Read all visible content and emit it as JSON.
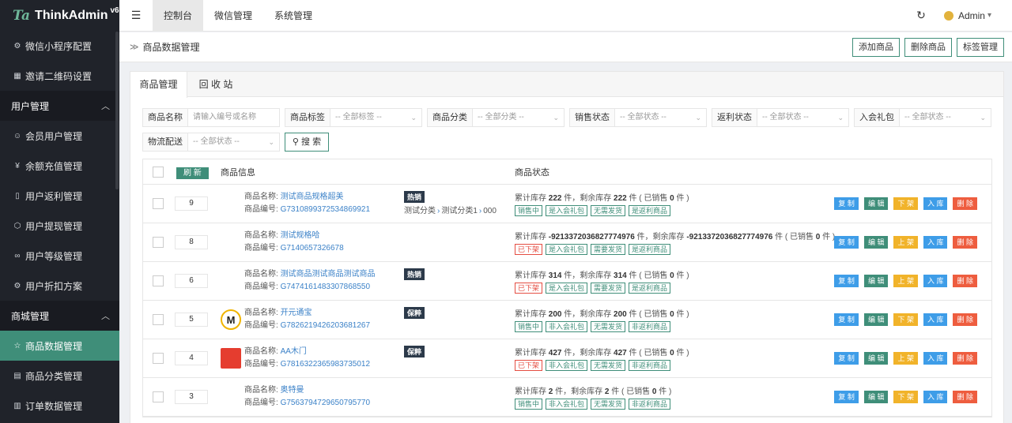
{
  "brand": {
    "name": "ThinkAdmin",
    "version": "v6",
    "mark": "Ta"
  },
  "sidebar": {
    "items_top": [
      {
        "label": "微信小程序配置",
        "icon": "gear-icon",
        "glyph": "⚙"
      },
      {
        "label": "邀请二维码设置",
        "icon": "qrcode-icon",
        "glyph": "▦"
      }
    ],
    "group_user": {
      "label": "用户管理",
      "chevron": "︿"
    },
    "items_user": [
      {
        "label": "会员用户管理",
        "icon": "user-icon",
        "glyph": "☺"
      },
      {
        "label": "余额充值管理",
        "icon": "yen-icon",
        "glyph": "¥"
      },
      {
        "label": "用户返利管理",
        "icon": "rebate-icon",
        "glyph": "▯"
      },
      {
        "label": "用户提现管理",
        "icon": "cube-icon",
        "glyph": "⬡"
      },
      {
        "label": "用户等级管理",
        "icon": "infinity-icon",
        "glyph": "∞"
      },
      {
        "label": "用户折扣方案",
        "icon": "settings-icon",
        "glyph": "⚙"
      }
    ],
    "group_mall": {
      "label": "商城管理",
      "chevron": "︿"
    },
    "items_mall": [
      {
        "label": "商品数据管理",
        "icon": "star-icon",
        "glyph": "☆",
        "active": true
      },
      {
        "label": "商品分类管理",
        "icon": "calendar-icon",
        "glyph": "▤"
      },
      {
        "label": "订单数据管理",
        "icon": "order-icon",
        "glyph": "▥"
      }
    ]
  },
  "topbar": {
    "menu_glyph": "☰",
    "nav": [
      {
        "label": "控制台",
        "active": true
      },
      {
        "label": "微信管理",
        "active": false
      },
      {
        "label": "系统管理",
        "active": false
      }
    ],
    "refresh_glyph": "↻",
    "user": "Admin",
    "user_caret": "▾"
  },
  "crumb": {
    "arrow": "≫",
    "title": "商品数据管理",
    "actions": [
      "添加商品",
      "删除商品",
      "标签管理"
    ]
  },
  "tabs": [
    "商品管理",
    "回 收 站"
  ],
  "filters": {
    "row1": [
      {
        "label": "商品名称",
        "placeholder": "请输入编号或名称",
        "dropdown": false
      },
      {
        "label": "商品标签",
        "placeholder": "-- 全部标签 --",
        "dropdown": true
      },
      {
        "label": "商品分类",
        "placeholder": "-- 全部分类 --",
        "dropdown": true
      },
      {
        "label": "销售状态",
        "placeholder": "-- 全部状态 --",
        "dropdown": true
      },
      {
        "label": "返利状态",
        "placeholder": "-- 全部状态 --",
        "dropdown": true
      },
      {
        "label": "入会礼包",
        "placeholder": "-- 全部状态 --",
        "dropdown": true
      }
    ],
    "row2": [
      {
        "label": "物流配送",
        "placeholder": "-- 全部状态 --",
        "dropdown": true
      }
    ],
    "search_label": "搜 索",
    "search_glyph": "⚲",
    "caret": "⌄"
  },
  "table": {
    "refresh_label": "刷 新",
    "col_info": "商品信息",
    "col_status": "商品状态",
    "name_prefix": "商品名称:",
    "code_prefix": "商品编号:",
    "rows": [
      {
        "sort": "9",
        "thumb": "none",
        "name": "测试商品规格超美",
        "code": "G7310899372534869921",
        "tag": "热销",
        "catpath": [
          "测试分类",
          "测试分类1",
          "000"
        ],
        "stock_total": "222",
        "stock_left": "222",
        "sold": "0",
        "badges": [
          {
            "text": "销售中",
            "color": "green"
          },
          {
            "text": "是入会礼包",
            "color": "green"
          },
          {
            "text": "无需发货",
            "color": "green"
          },
          {
            "text": "是返利商品",
            "color": "green"
          }
        ],
        "shelf_action": "下 架"
      },
      {
        "sort": "8",
        "thumb": "none",
        "name": "测试规格哈",
        "code": "G7140657326678",
        "tag": "",
        "catpath": [],
        "stock_total": "-9213372036827774976",
        "stock_left": "-9213372036827774976",
        "sold": "0",
        "badges": [
          {
            "text": "已下架",
            "color": "red"
          },
          {
            "text": "是入会礼包",
            "color": "green"
          },
          {
            "text": "需要发货",
            "color": "green"
          },
          {
            "text": "是返利商品",
            "color": "green"
          }
        ],
        "shelf_action": "上 架"
      },
      {
        "sort": "6",
        "thumb": "none",
        "name": "测试商品测试商品测试商品",
        "code": "G7474161483307868550",
        "tag": "热销",
        "catpath": [],
        "stock_total": "314",
        "stock_left": "314",
        "sold": "0",
        "badges": [
          {
            "text": "已下架",
            "color": "red"
          },
          {
            "text": "是入会礼包",
            "color": "green"
          },
          {
            "text": "需要发货",
            "color": "green"
          },
          {
            "text": "是返利商品",
            "color": "green"
          }
        ],
        "shelf_action": "上 架"
      },
      {
        "sort": "5",
        "thumb": "m",
        "name": "开元通宝",
        "code": "G7826219426203681267",
        "tag": "保粹",
        "catpath": [],
        "stock_total": "200",
        "stock_left": "200",
        "sold": "0",
        "badges": [
          {
            "text": "销售中",
            "color": "green"
          },
          {
            "text": "非入会礼包",
            "color": "green"
          },
          {
            "text": "无需发货",
            "color": "green"
          },
          {
            "text": "非返利商品",
            "color": "green"
          }
        ],
        "shelf_action": "下 架"
      },
      {
        "sort": "4",
        "thumb": "red",
        "name": "AA木门",
        "code": "G7816322365983735012",
        "tag": "保粹",
        "catpath": [],
        "stock_total": "427",
        "stock_left": "427",
        "sold": "0",
        "badges": [
          {
            "text": "已下架",
            "color": "red"
          },
          {
            "text": "非入会礼包",
            "color": "green"
          },
          {
            "text": "无需发货",
            "color": "green"
          },
          {
            "text": "非返利商品",
            "color": "green"
          }
        ],
        "shelf_action": "上 架"
      },
      {
        "sort": "3",
        "thumb": "none",
        "name": "奥特曼",
        "code": "G7563794729650795770",
        "tag": "",
        "catpath": [],
        "stock_total": "2",
        "stock_left": "2",
        "sold": "0",
        "badges": [
          {
            "text": "销售中",
            "color": "green"
          },
          {
            "text": "非入会礼包",
            "color": "green"
          },
          {
            "text": "无需发货",
            "color": "green"
          },
          {
            "text": "非返利商品",
            "color": "green"
          }
        ],
        "shelf_action": "下 架"
      }
    ],
    "actions": {
      "copy": "复 制",
      "edit": "编 辑",
      "stock_in": "入 库",
      "delete": "删 除"
    },
    "stock_text": {
      "p1": "累计库存 ",
      "p2": " 件，剩余库存 ",
      "p3": " 件 ( 已销售 ",
      "p4": " 件 )"
    },
    "cat_sep": "›"
  },
  "colors": {
    "accent": "#3f8e79",
    "sidebar_bg": "#20232a",
    "link": "#3c82c8",
    "danger": "#e54d42"
  }
}
